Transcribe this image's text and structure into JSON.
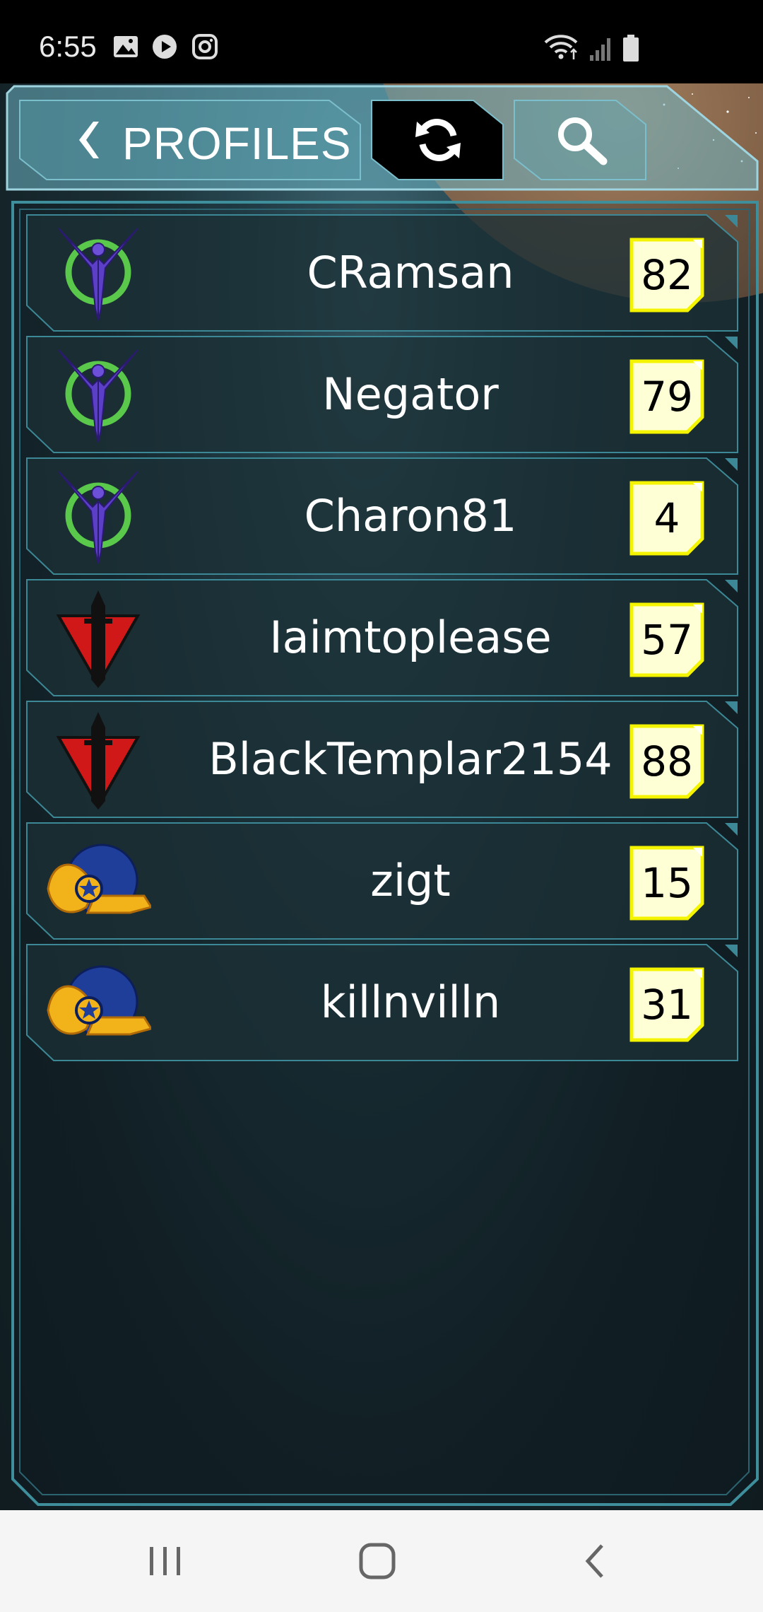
{
  "status_bar": {
    "time": "6:55",
    "left_icons": [
      "image-icon",
      "play-icon",
      "instagram-icon"
    ],
    "right_icons": [
      "wifi-icon",
      "signal-icon",
      "battery-icon"
    ]
  },
  "header": {
    "title": "PROFILES",
    "back_icon": "chevron-left-icon",
    "refresh_icon": "refresh-icon",
    "search_icon": "search-icon"
  },
  "profiles": [
    {
      "name": "CRamsan",
      "score": "82",
      "faction": "winged-faction-icon"
    },
    {
      "name": "Negator",
      "score": "79",
      "faction": "winged-faction-icon"
    },
    {
      "name": "Charon81",
      "score": "4",
      "faction": "winged-faction-icon"
    },
    {
      "name": "Iaimtoplease",
      "score": "57",
      "faction": "red-triangle-faction-icon"
    },
    {
      "name": "BlackTemplar2154",
      "score": "88",
      "faction": "red-triangle-faction-icon"
    },
    {
      "name": "zigt",
      "score": "15",
      "faction": "eagle-star-faction-icon"
    },
    {
      "name": "killnvilln",
      "score": "31",
      "faction": "eagle-star-faction-icon"
    }
  ],
  "colors": {
    "accent_cyan": "#5fa9b8",
    "score_badge_fill": "#ffffd6",
    "score_badge_border": "#f4f400",
    "winged_green": "#5ac84a",
    "winged_purple": "#5b3fc6",
    "red_faction": "#d01818",
    "eagle_blue": "#1f3e9a",
    "eagle_gold": "#f2b21a"
  },
  "nav_bar": {
    "recent_icon": "recent-apps-icon",
    "home_icon": "home-icon",
    "back_icon": "back-icon"
  }
}
